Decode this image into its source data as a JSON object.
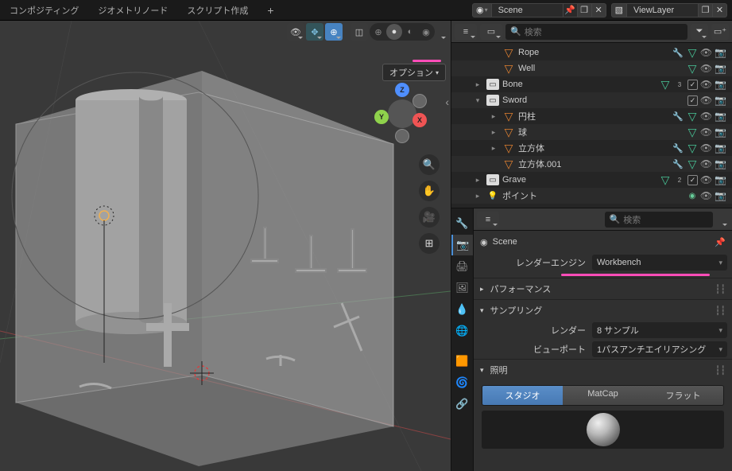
{
  "top": {
    "tabs": [
      "コンポジティング",
      "ジオメトリノード",
      "スクリプト作成"
    ],
    "scene_label": "Scene",
    "viewlayer_label": "ViewLayer"
  },
  "viewport": {
    "options_label": "オプション",
    "axes": {
      "x": "X",
      "y": "Y",
      "z": "Z"
    }
  },
  "outliner": {
    "search_placeholder": "検索",
    "rows": [
      {
        "type": "obj",
        "name": "Rope",
        "indent": 2,
        "expand": "",
        "mods": [
          "wrench",
          "vg"
        ],
        "toggles": [
          "eye",
          "cam"
        ]
      },
      {
        "type": "obj",
        "name": "Well",
        "indent": 2,
        "expand": "",
        "mods": [
          "vg"
        ],
        "toggles": [
          "eye",
          "cam"
        ]
      },
      {
        "type": "coll",
        "name": "Bone",
        "indent": 1,
        "expand": "closed",
        "mods": [
          "vg",
          "3"
        ],
        "toggles": [
          "chk",
          "eye",
          "cam"
        ]
      },
      {
        "type": "coll",
        "name": "Sword",
        "indent": 1,
        "expand": "open",
        "mods": [],
        "toggles": [
          "chk",
          "eye",
          "cam"
        ]
      },
      {
        "type": "obj",
        "name": "円柱",
        "indent": 2,
        "expand": "closed",
        "mods": [
          "wrench",
          "vg"
        ],
        "toggles": [
          "eye",
          "cam"
        ]
      },
      {
        "type": "obj",
        "name": "球",
        "indent": 2,
        "expand": "closed",
        "mods": [
          "vg"
        ],
        "toggles": [
          "eye",
          "cam"
        ]
      },
      {
        "type": "obj",
        "name": "立方体",
        "indent": 2,
        "expand": "closed",
        "mods": [
          "wrench",
          "vg"
        ],
        "toggles": [
          "eye",
          "cam"
        ]
      },
      {
        "type": "obj",
        "name": "立方体.001",
        "indent": 2,
        "expand": "",
        "mods": [
          "wrench",
          "vg"
        ],
        "toggles": [
          "eye",
          "cam"
        ]
      },
      {
        "type": "coll",
        "name": "Grave",
        "indent": 1,
        "expand": "closed",
        "mods": [
          "vg",
          "2"
        ],
        "toggles": [
          "chk",
          "eye",
          "cam"
        ]
      },
      {
        "type": "light",
        "name": "ポイント",
        "indent": 1,
        "expand": "closed",
        "mods": [
          "data"
        ],
        "toggles": [
          "eye",
          "cam"
        ]
      }
    ]
  },
  "properties": {
    "search_placeholder": "検索",
    "breadcrumb": "Scene",
    "render_engine_label": "レンダーエンジン",
    "render_engine_value": "Workbench",
    "sections": {
      "performance": "パフォーマンス",
      "sampling": "サンプリング",
      "lighting": "照明"
    },
    "render_label": "レンダー",
    "render_value": "8 サンプル",
    "viewport_label": "ビューポート",
    "viewport_value": "1パスアンチエイリアシング",
    "light_tabs": [
      "スタジオ",
      "MatCap",
      "フラット"
    ]
  }
}
